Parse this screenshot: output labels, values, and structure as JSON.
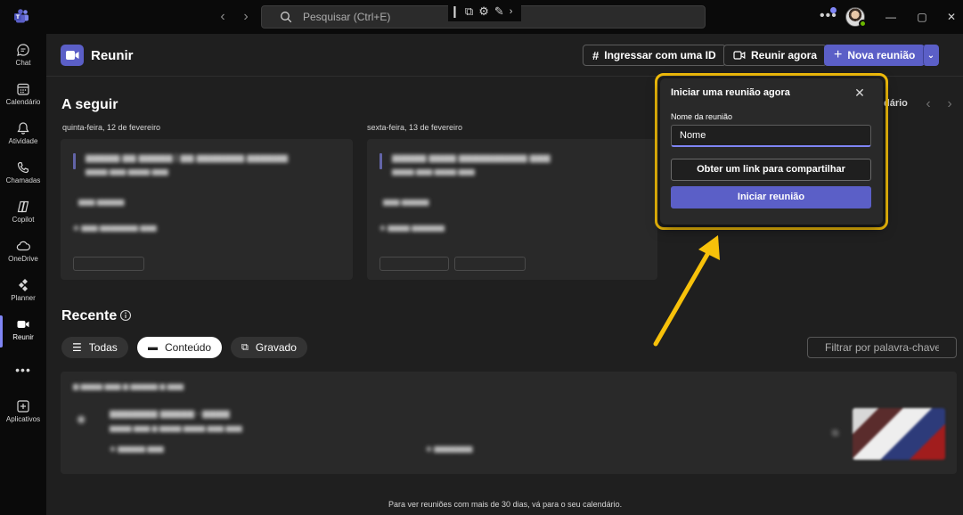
{
  "titlebar": {
    "search_placeholder": "Pesquisar (Ctrl+E)",
    "back_icon": "chevron-left-icon",
    "forward_icon": "chevron-right-icon",
    "more_label": "•••",
    "minimize": "—",
    "maximize": "▢",
    "close": "✕"
  },
  "rail": {
    "items": [
      {
        "label": "Chat",
        "icon": "chat-icon"
      },
      {
        "label": "Calendário",
        "icon": "calendar-icon"
      },
      {
        "label": "Atividade",
        "icon": "bell-icon"
      },
      {
        "label": "Chamadas",
        "icon": "phone-icon"
      },
      {
        "label": "Copilot",
        "icon": "copilot-icon"
      },
      {
        "label": "OneDrive",
        "icon": "cloud-icon"
      },
      {
        "label": "Planner",
        "icon": "planner-icon"
      },
      {
        "label": "Reunir",
        "icon": "video-icon",
        "active": true
      },
      {
        "label": "•••",
        "icon": "more-icon"
      },
      {
        "label": "Aplicativos",
        "icon": "add-app-icon"
      }
    ]
  },
  "header": {
    "title": "Reunir",
    "join_id_label": "Ingressar com uma ID",
    "meet_now_label": "Reunir agora",
    "new_meeting_label": "Nova reunião"
  },
  "upcoming": {
    "title": "A seguir",
    "calendar_link": "dário",
    "days": [
      {
        "date": "quinta-feira, 12 de fevereiro"
      },
      {
        "date": "sexta-feira, 13 de fevereiro"
      }
    ]
  },
  "recent": {
    "title": "Recente",
    "filters": [
      {
        "label": "Todas",
        "active": false
      },
      {
        "label": "Conteúdo",
        "active": true
      },
      {
        "label": "Gravado",
        "active": false
      }
    ],
    "keyword_placeholder": "Filtrar por palavra-chave",
    "footer_note": "Para ver reuniões com mais de 30 dias, vá para o seu calendário."
  },
  "popover": {
    "title": "Iniciar uma reunião agora",
    "name_label": "Nome da reunião",
    "name_value": "Nome",
    "share_link_label": "Obter um link para compartilhar",
    "start_label": "Iniciar reunião"
  },
  "colors": {
    "accent": "#5b5fc7",
    "highlight": "#f7c10a",
    "presence": "#6bb700"
  }
}
